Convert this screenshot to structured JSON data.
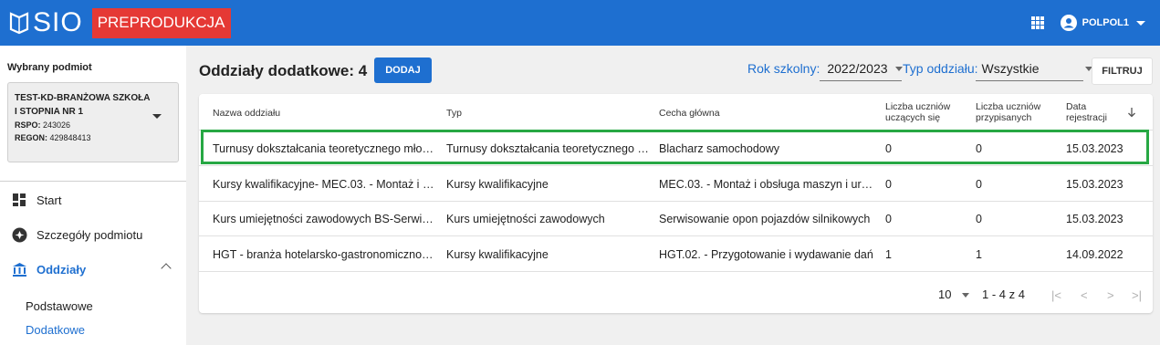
{
  "header": {
    "logo_text": "SIO",
    "env_badge": "PREPRODUKCJA",
    "user_name": "POLPOL1"
  },
  "sidebar": {
    "heading": "Wybrany podmiot",
    "entity": {
      "name": "TEST-KD-BRANŻOWA SZKOŁA I STOPNIA NR 1",
      "rspo_label": "RSPO:",
      "rspo_value": "243026",
      "regon_label": "REGON:",
      "regon_value": "429848413"
    },
    "nav": [
      {
        "label": "Start",
        "icon": "dashboard-icon"
      },
      {
        "label": "Szczegóły podmiotu",
        "icon": "info-icon"
      },
      {
        "label": "Oddziały",
        "icon": "institution-icon"
      }
    ],
    "subnav": [
      {
        "label": "Podstawowe"
      },
      {
        "label": "Dodatkowe"
      }
    ]
  },
  "main": {
    "title": "Oddziały dodatkowe: 4",
    "add_button": "DODAJ",
    "filters": {
      "year_label": "Rok szkolny:",
      "year_value": "2022/2023",
      "type_label": "Typ oddziału:",
      "type_value": "Wszystkie",
      "filter_button": "FILTRUJ"
    },
    "table": {
      "headers": {
        "name": "Nazwa oddziału",
        "type": "Typ",
        "feature": "Cecha główna",
        "learning_l1": "Liczba uczniów",
        "learning_l2": "uczących się",
        "assigned_l1": "Liczba uczniów",
        "assigned_l2": "przypisanych",
        "date_l1": "Data",
        "date_l2": "rejestracji"
      },
      "rows": [
        {
          "name": "Turnusy dokształcania teoretycznego mło…",
          "type": "Turnusy dokształcania teoretycznego …",
          "feature": "Blacharz samochodowy",
          "learning": "0",
          "assigned": "0",
          "date": "15.03.2023"
        },
        {
          "name": "Kursy kwalifikacyjne- MEC.03. - Montaż i o…",
          "type": "Kursy kwalifikacyjne",
          "feature": "MEC.03. - Montaż i obsługa maszyn i urz…",
          "learning": "0",
          "assigned": "0",
          "date": "15.03.2023"
        },
        {
          "name": "Kurs umiejętności zawodowych BS-Serwis…",
          "type": "Kurs umiejętności zawodowych",
          "feature": "Serwisowanie opon pojazdów silnikowych",
          "learning": "0",
          "assigned": "0",
          "date": "15.03.2023"
        },
        {
          "name": "HGT - branża hotelarsko-gastronomiczno-t…",
          "type": "Kursy kwalifikacyjne",
          "feature": "HGT.02. - Przygotowanie i wydawanie dań",
          "learning": "1",
          "assigned": "1",
          "date": "14.09.2022"
        }
      ]
    },
    "pager": {
      "page_size": "10",
      "range": "1 - 4 z 4",
      "first": "|<",
      "prev": "<",
      "next": ">",
      "last": ">|"
    }
  },
  "colors": {
    "brand": "#1e6fd0",
    "badge": "#e53935",
    "highlight": "#27a844"
  }
}
